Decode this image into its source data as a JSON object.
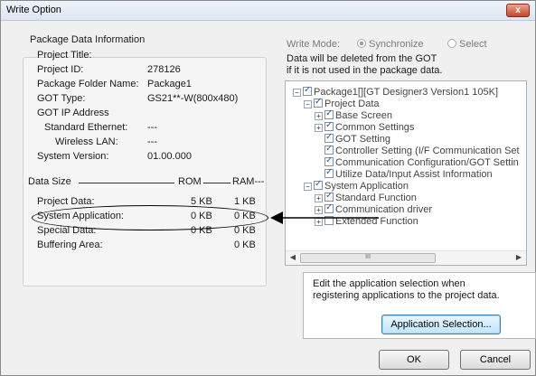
{
  "window": {
    "title": "Write Option",
    "close_label": "x"
  },
  "package_info": {
    "section_label": "Package Data Information",
    "project_title_label": "Project Title:",
    "project_title_value": "",
    "project_id_label": "Project ID:",
    "project_id_value": "278126",
    "folder_label": "Package Folder Name:",
    "folder_value": "Package1",
    "got_type_label": "GOT Type:",
    "got_type_value": "GS21**-W(800x480)",
    "ip_label": "GOT IP Address",
    "ethernet_label": "Standard Ethernet:",
    "ethernet_value": "---",
    "wireless_label": "Wireless LAN:",
    "wireless_value": "---",
    "system_version_label": "System Version:",
    "system_version_value": "01.00.000"
  },
  "data_size": {
    "header_label": "Data Size",
    "header_rom": "ROM",
    "header_ram": "RAM---",
    "rows": [
      {
        "label": "Project Data:",
        "rom": "5 KB",
        "ram": "1 KB"
      },
      {
        "label": "System Application:",
        "rom": "0 KB",
        "ram": "0 KB"
      },
      {
        "label": "Special Data:",
        "rom": "0 KB",
        "ram": "0 KB"
      },
      {
        "label": "Buffering Area:",
        "rom": "",
        "ram": "0 KB"
      }
    ]
  },
  "write_mode": {
    "label": "Write Mode:",
    "option_synchronize": "Synchronize",
    "option_select": "Select",
    "selected": "Synchronize"
  },
  "note": {
    "line1": "Data will be deleted from the GOT",
    "line2": "if it is not used in the package data."
  },
  "tree": {
    "items": [
      {
        "label": "Package1[][GT Designer3 Version1 105K]",
        "checked": true,
        "expander": "minus"
      },
      {
        "label": "Project Data",
        "checked": true,
        "expander": "minus"
      },
      {
        "label": "Base Screen",
        "checked": true,
        "expander": "plus"
      },
      {
        "label": "Common Settings",
        "checked": true,
        "expander": "plus"
      },
      {
        "label": "GOT Setting",
        "checked": true,
        "expander": "none"
      },
      {
        "label": "Controller Setting (I/F Communication Set",
        "checked": true,
        "expander": "none"
      },
      {
        "label": "Communication Configuration/GOT Settin",
        "checked": true,
        "expander": "none"
      },
      {
        "label": "Utilize Data/Input Assist Information",
        "checked": true,
        "expander": "none"
      },
      {
        "label": "System Application",
        "checked": true,
        "expander": "minus"
      },
      {
        "label": "Standard Function",
        "checked": true,
        "expander": "plus"
      },
      {
        "label": "Communication driver",
        "checked": true,
        "expander": "plus"
      },
      {
        "label": "Extended Function",
        "checked": false,
        "expander": "plus"
      }
    ],
    "scroll_thumb_glyph": "III"
  },
  "info_box": {
    "line1": "Edit the application selection when",
    "line2": "registering applications to the project data."
  },
  "buttons": {
    "application_selection": "Application Selection...",
    "ok": "OK",
    "cancel": "Cancel"
  }
}
